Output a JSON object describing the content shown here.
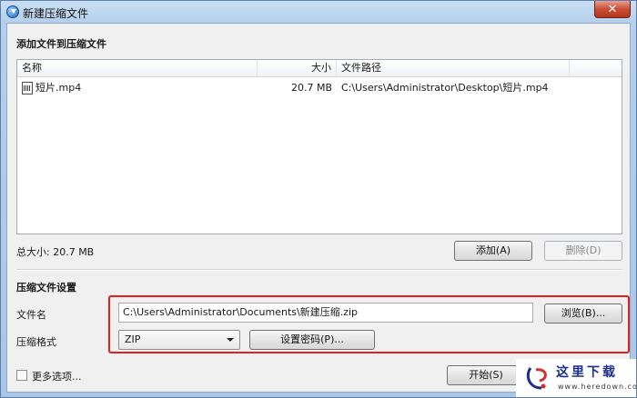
{
  "window": {
    "title": "新建压缩文件",
    "close_label": "✕"
  },
  "add_section": {
    "title": "添加文件到压缩文件"
  },
  "file_list": {
    "columns": [
      "名称",
      "大小",
      "文件路径"
    ],
    "rows": [
      {
        "name": "短片.mp4",
        "size": "20.7 MB",
        "path": "C:\\Users\\Administrator\\Desktop\\短片.mp4",
        "icon": "video-file-icon"
      }
    ]
  },
  "total_size": "总大小: 20.7 MB",
  "buttons": {
    "add": "添加(A)",
    "delete": "删除(D)",
    "browse": "浏览(B)...",
    "set_password": "设置密码(P)...",
    "start": "开始(S)"
  },
  "settings_section": {
    "title": "压缩文件设置"
  },
  "filename": {
    "label": "文件名",
    "value": "C:\\Users\\Administrator\\Documents\\新建压缩.zip"
  },
  "format": {
    "label": "压缩格式",
    "selected": "ZIP"
  },
  "more_options": {
    "label": "更多选项...",
    "checked": false
  },
  "watermark": {
    "brand": "这里下载",
    "url": "www.heredown.com"
  },
  "colors": {
    "highlight": "#e02020",
    "titlebar": "#b5cfec",
    "close_button": "#c94f35"
  }
}
